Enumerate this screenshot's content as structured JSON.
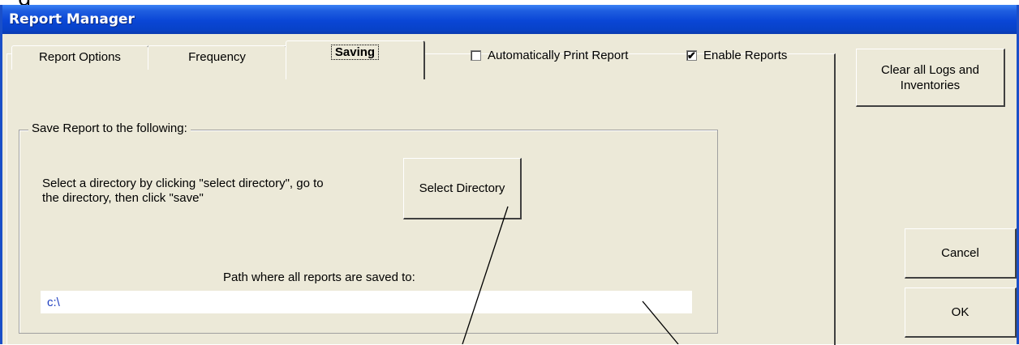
{
  "cropped_top_text": "g",
  "window": {
    "title": "Report Manager"
  },
  "tabs": [
    {
      "label": "Report Options",
      "active": false
    },
    {
      "label": "Frequency",
      "active": false
    },
    {
      "label": "Saving",
      "active": true
    }
  ],
  "options": {
    "auto_print": {
      "label": "Automatically Print Report",
      "checked": false,
      "mark": ""
    },
    "enable_reports": {
      "label": "Enable Reports",
      "checked": true,
      "mark": "✔"
    }
  },
  "saving": {
    "group_title": "Save Report to the following:",
    "description": "Select a directory by clicking \"select directory\", go to\nthe directory, then click \"save\"",
    "select_directory_label": "Select Directory",
    "path_label": "Path where all reports are saved to:",
    "path_value": "c:\\"
  },
  "side_buttons": {
    "clear_label": "Clear all Logs and\nInventories",
    "cancel_label": "Cancel",
    "ok_label": "OK"
  }
}
